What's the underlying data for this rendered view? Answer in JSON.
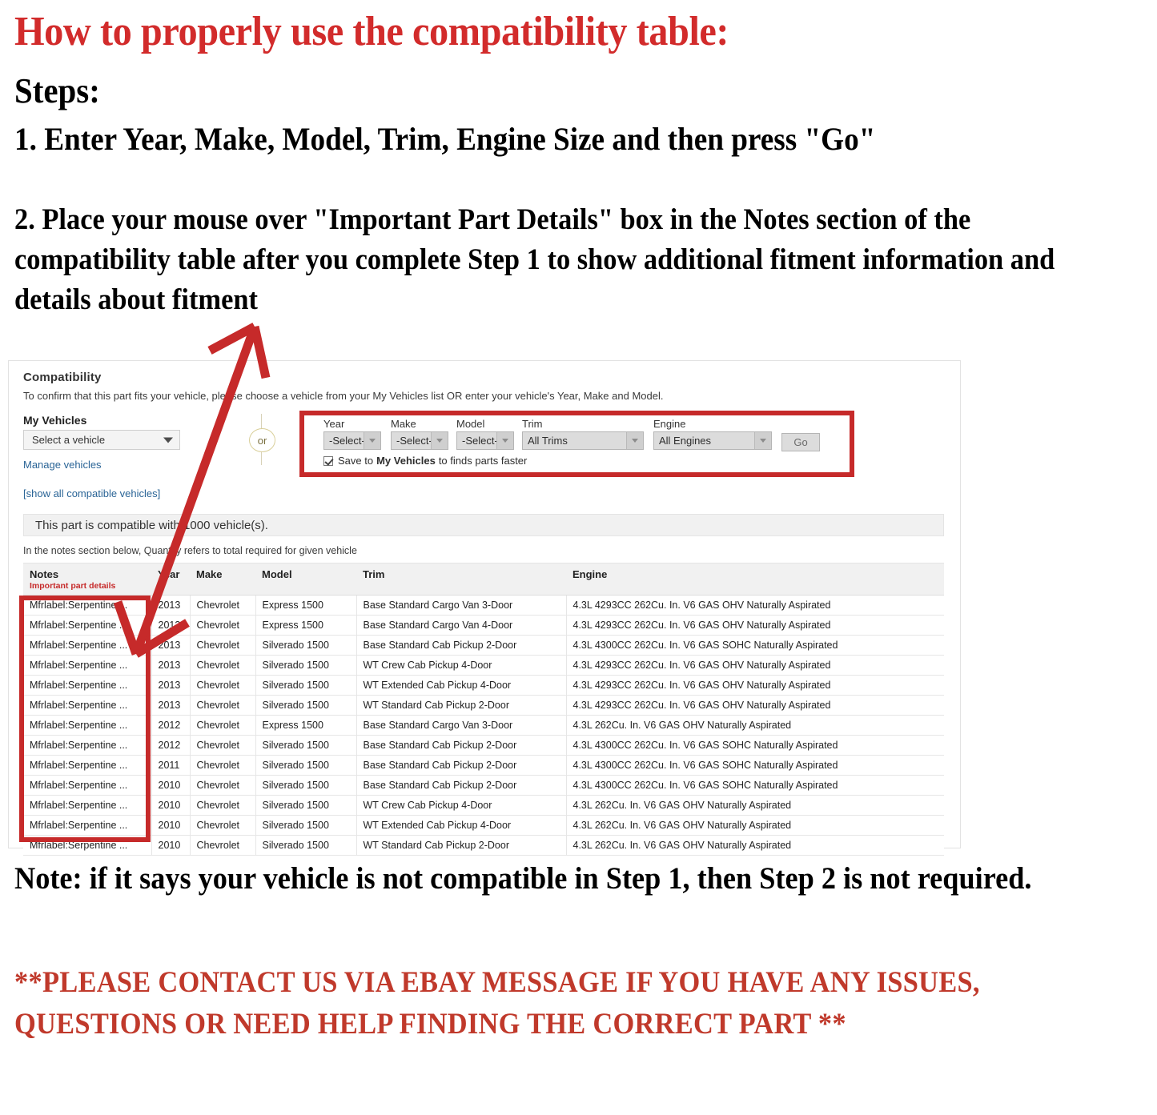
{
  "instructions": {
    "title": "How to properly use the compatibility table:",
    "steps_heading": "Steps:",
    "step_one": "1. Enter Year, Make, Model, Trim, Engine Size and then press \"Go\"",
    "step_two": "2. Place your mouse over \"Important Part Details\" box in the Notes section of the compatibility table after you complete Step 1 to show additional fitment information and details about fitment",
    "bottom_note": "Note: if it says your vehicle is not compatible in Step 1, then Step 2 is not required.",
    "footer_message": "**PLEASE CONTACT US VIA EBAY MESSAGE IF YOU HAVE ANY ISSUES, QUESTIONS OR NEED HELP FINDING THE CORRECT PART **"
  },
  "colors": {
    "accent_red": "#D22B2B",
    "highlight_box_red": "#C62A2A",
    "link_blue": "#2a6496",
    "footer_red": "#C0392B"
  },
  "compatibility": {
    "panel_title": "Compatibility",
    "panel_subtitle": "To confirm that this part fits your vehicle, please choose a vehicle from your My Vehicles list OR enter your vehicle's Year, Make and Model.",
    "my_vehicles": {
      "label": "My Vehicles",
      "select_value": "Select a vehicle",
      "manage_link": "Manage vehicles"
    },
    "or_divider": "or",
    "search_form": {
      "year": {
        "label": "Year",
        "value": "-Select-"
      },
      "make": {
        "label": "Make",
        "value": "-Select-"
      },
      "model": {
        "label": "Model",
        "value": "-Select-"
      },
      "trim": {
        "label": "Trim",
        "value": "All Trims"
      },
      "engine": {
        "label": "Engine",
        "value": "All Engines"
      },
      "go_button": "Go",
      "save_prefix": "Save to",
      "save_bold": "My Vehicles",
      "save_suffix": "to finds parts faster"
    },
    "show_all_link": "[show all compatible vehicles]",
    "compatible_banner": "This part is compatible with 1000 vehicle(s).",
    "quantity_note": "In the notes section below, Quantity refers to total required for given vehicle",
    "table": {
      "headers": {
        "notes": "Notes",
        "notes_sub": "Important part details",
        "year": "Year",
        "make": "Make",
        "model": "Model",
        "trim": "Trim",
        "engine": "Engine"
      },
      "rows": [
        {
          "notes": "Mfrlabel:Serpentine ...",
          "year": "2013",
          "make": "Chevrolet",
          "model": "Express 1500",
          "trim": "Base Standard Cargo Van 3-Door",
          "engine": "4.3L 4293CC 262Cu. In. V6 GAS OHV Naturally Aspirated"
        },
        {
          "notes": "Mfrlabel:Serpentine ...",
          "year": "2013",
          "make": "Chevrolet",
          "model": "Express 1500",
          "trim": "Base Standard Cargo Van 4-Door",
          "engine": "4.3L 4293CC 262Cu. In. V6 GAS OHV Naturally Aspirated"
        },
        {
          "notes": "Mfrlabel:Serpentine ...",
          "year": "2013",
          "make": "Chevrolet",
          "model": "Silverado 1500",
          "trim": "Base Standard Cab Pickup 2-Door",
          "engine": "4.3L 4300CC 262Cu. In. V6 GAS SOHC Naturally Aspirated"
        },
        {
          "notes": "Mfrlabel:Serpentine ...",
          "year": "2013",
          "make": "Chevrolet",
          "model": "Silverado 1500",
          "trim": "WT Crew Cab Pickup 4-Door",
          "engine": "4.3L 4293CC 262Cu. In. V6 GAS OHV Naturally Aspirated"
        },
        {
          "notes": "Mfrlabel:Serpentine ...",
          "year": "2013",
          "make": "Chevrolet",
          "model": "Silverado 1500",
          "trim": "WT Extended Cab Pickup 4-Door",
          "engine": "4.3L 4293CC 262Cu. In. V6 GAS OHV Naturally Aspirated"
        },
        {
          "notes": "Mfrlabel:Serpentine ...",
          "year": "2013",
          "make": "Chevrolet",
          "model": "Silverado 1500",
          "trim": "WT Standard Cab Pickup 2-Door",
          "engine": "4.3L 4293CC 262Cu. In. V6 GAS OHV Naturally Aspirated"
        },
        {
          "notes": "Mfrlabel:Serpentine ...",
          "year": "2012",
          "make": "Chevrolet",
          "model": "Express 1500",
          "trim": "Base Standard Cargo Van 3-Door",
          "engine": "4.3L 262Cu. In. V6 GAS OHV Naturally Aspirated"
        },
        {
          "notes": "Mfrlabel:Serpentine ...",
          "year": "2012",
          "make": "Chevrolet",
          "model": "Silverado 1500",
          "trim": "Base Standard Cab Pickup 2-Door",
          "engine": "4.3L 4300CC 262Cu. In. V6 GAS SOHC Naturally Aspirated"
        },
        {
          "notes": "Mfrlabel:Serpentine ...",
          "year": "2011",
          "make": "Chevrolet",
          "model": "Silverado 1500",
          "trim": "Base Standard Cab Pickup 2-Door",
          "engine": "4.3L 4300CC 262Cu. In. V6 GAS SOHC Naturally Aspirated"
        },
        {
          "notes": "Mfrlabel:Serpentine ...",
          "year": "2010",
          "make": "Chevrolet",
          "model": "Silverado 1500",
          "trim": "Base Standard Cab Pickup 2-Door",
          "engine": "4.3L 4300CC 262Cu. In. V6 GAS SOHC Naturally Aspirated"
        },
        {
          "notes": "Mfrlabel:Serpentine ...",
          "year": "2010",
          "make": "Chevrolet",
          "model": "Silverado 1500",
          "trim": "WT Crew Cab Pickup 4-Door",
          "engine": "4.3L 262Cu. In. V6 GAS OHV Naturally Aspirated"
        },
        {
          "notes": "Mfrlabel:Serpentine ...",
          "year": "2010",
          "make": "Chevrolet",
          "model": "Silverado 1500",
          "trim": "WT Extended Cab Pickup 4-Door",
          "engine": "4.3L 262Cu. In. V6 GAS OHV Naturally Aspirated"
        },
        {
          "notes": "Mfrlabel:Serpentine ...",
          "year": "2010",
          "make": "Chevrolet",
          "model": "Silverado 1500",
          "trim": "WT Standard Cab Pickup 2-Door",
          "engine": "4.3L 262Cu. In. V6 GAS OHV Naturally Aspirated"
        }
      ]
    }
  }
}
